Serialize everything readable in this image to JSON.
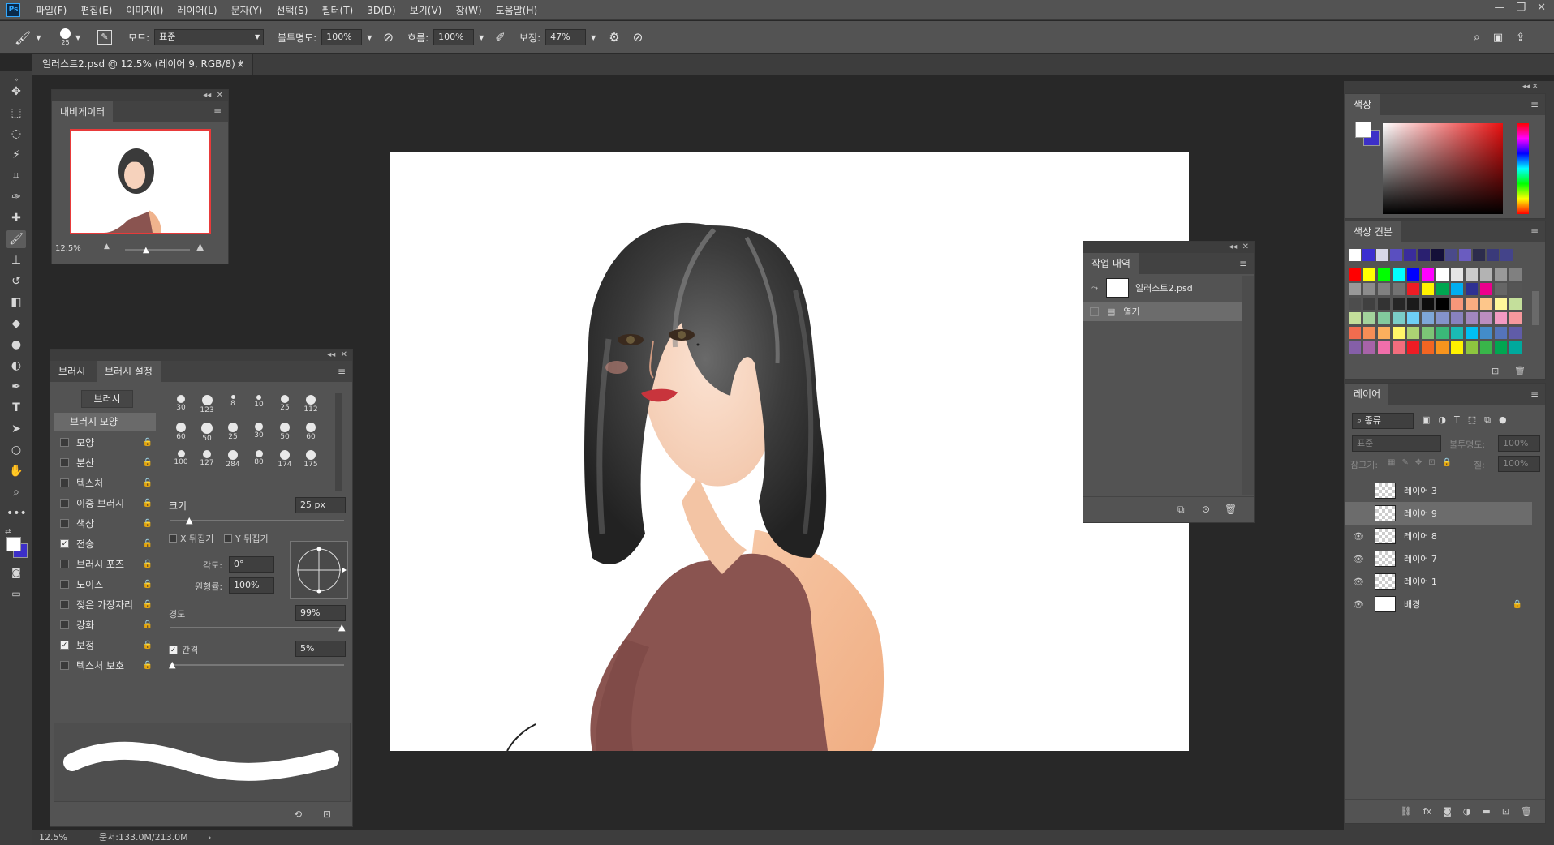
{
  "app": {
    "logo": "Ps"
  },
  "menu": [
    "파일(F)",
    "편집(E)",
    "이미지(I)",
    "레이어(L)",
    "문자(Y)",
    "선택(S)",
    "필터(T)",
    "3D(D)",
    "보기(V)",
    "창(W)",
    "도움말(H)"
  ],
  "window_buttons": [
    "—",
    "❐",
    "✕"
  ],
  "options": {
    "brush_size": "25",
    "mode_label": "모드:",
    "mode_value": "표준",
    "opacity_label": "불투명도:",
    "opacity_value": "100%",
    "flow_label": "흐름:",
    "flow_value": "100%",
    "smoothing_label": "보정:",
    "smoothing_value": "47%"
  },
  "document_tab": "일러스트2.psd @ 12.5% (레이어 9, RGB/8) *",
  "navigator": {
    "title": "내비게이터",
    "zoom": "12.5%"
  },
  "brush_panel": {
    "tabs": [
      "브러시",
      "브러시 설정"
    ],
    "brushes_button": "브러시",
    "tip_shape_label": "브러시 모양",
    "options": [
      {
        "label": "모양",
        "checked": false
      },
      {
        "label": "분산",
        "checked": false
      },
      {
        "label": "텍스처",
        "checked": false
      },
      {
        "label": "이중 브러시",
        "checked": false
      },
      {
        "label": "색상",
        "checked": false
      },
      {
        "label": "전송",
        "checked": true
      },
      {
        "label": "브러시 포즈",
        "checked": false
      },
      {
        "label": "노이즈",
        "checked": false
      },
      {
        "label": "젖은 가장자리",
        "checked": false
      },
      {
        "label": "강화",
        "checked": false
      },
      {
        "label": "보정",
        "checked": true
      },
      {
        "label": "텍스처 보호",
        "checked": false
      }
    ],
    "tip_sizes": [
      "30",
      "123",
      "8",
      "10",
      "25",
      "112",
      "60",
      "50",
      "25",
      "30",
      "50",
      "60",
      "100",
      "127",
      "284",
      "80",
      "174",
      "175"
    ],
    "size_label": "크기",
    "size_value": "25 px",
    "flip_x": "X 뒤집기",
    "flip_y": "Y 뒤집기",
    "angle_label": "각도:",
    "angle_value": "0°",
    "roundness_label": "원형률:",
    "roundness_value": "100%",
    "hardness_label": "경도",
    "hardness_value": "99%",
    "spacing_label": "간격",
    "spacing_value": "5%",
    "spacing_checked": true
  },
  "history": {
    "title": "작업 내역",
    "items": [
      "일러스트2.psd",
      "열기"
    ]
  },
  "color": {
    "title": "색상",
    "foreground": "#ffffff",
    "background": "#3c2fc8"
  },
  "swatches": {
    "title": "색상 견본",
    "top_row": [
      "#ffffff",
      "#3b2ed0",
      "#d8d8e8",
      "#5a4fc0",
      "#3a2c9c",
      "#2a2070",
      "#141038",
      "#4a4a8a",
      "#6a5cc0",
      "#2c2c4c",
      "#3a3a7a",
      "#44448a"
    ],
    "grid": [
      [
        "#ff0000",
        "#ffff00",
        "#00ff00",
        "#00ffff",
        "#0000ff",
        "#ff00ff",
        "#ffffff",
        "#e6e6e6",
        "#cccccc",
        "#b3b3b3",
        "#999999",
        "#808080"
      ],
      [
        "#999999",
        "#8c8c8c",
        "#808080",
        "#737373",
        "#ed1c24",
        "#fff200",
        "#00a651",
        "#00aeef",
        "#2e3192",
        "#ec008c",
        "#666666",
        "#555555"
      ],
      [
        "#4d4d4d",
        "#404040",
        "#333333",
        "#262626",
        "#1a1a1a",
        "#0d0d0d",
        "#000000",
        "#f7977a",
        "#f9ad81",
        "#fdc68a",
        "#fff79a",
        "#c4df9b"
      ],
      [
        "#c4df9b",
        "#a3d39c",
        "#82ca9d",
        "#7bcdc8",
        "#6ecff6",
        "#7ea7d8",
        "#8493ca",
        "#8882be",
        "#a187be",
        "#bc8dbf",
        "#f49ac2",
        "#f6989d"
      ],
      [
        "#f26c4f",
        "#f68e56",
        "#fbaf5d",
        "#fff568",
        "#acd373",
        "#7cc576",
        "#3bb878",
        "#1abbb4",
        "#00bff3",
        "#438cca",
        "#5574b9",
        "#605ca8"
      ],
      [
        "#855fa8",
        "#a763a8",
        "#f06eaa",
        "#f26d7d",
        "#ed1c24",
        "#f26522",
        "#f7941d",
        "#fff200",
        "#8dc63f",
        "#39b54a",
        "#00a651",
        "#00a99d"
      ]
    ]
  },
  "layers": {
    "title": "레이어",
    "filter_label": "종류",
    "blend_mode": "표준",
    "opacity_label": "불투명도:",
    "opacity_value": "100%",
    "lock_label": "잠그기:",
    "fill_label": "칠:",
    "fill_value": "100%",
    "items": [
      {
        "name": "레이어 3",
        "visible": false,
        "selected": false
      },
      {
        "name": "레이어 9",
        "visible": false,
        "selected": true
      },
      {
        "name": "레이어 8",
        "visible": true,
        "selected": false
      },
      {
        "name": "레이어 7",
        "visible": true,
        "selected": false
      },
      {
        "name": "레이어 1",
        "visible": true,
        "selected": false
      },
      {
        "name": "배경",
        "visible": true,
        "selected": false,
        "locked": true
      }
    ]
  },
  "status": {
    "zoom": "12.5%",
    "doc": "문서:133.0M/213.0M"
  }
}
